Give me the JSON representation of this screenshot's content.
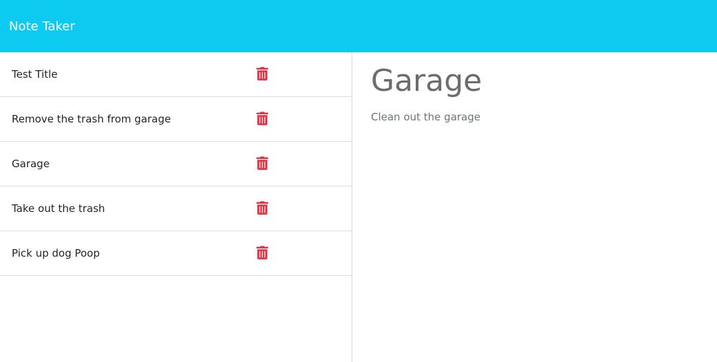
{
  "header": {
    "brand": "Note Taker"
  },
  "notes": [
    {
      "title": "Test Title"
    },
    {
      "title": "Remove the trash from garage"
    },
    {
      "title": "Garage"
    },
    {
      "title": "Take out the trash"
    },
    {
      "title": "Pick up dog Poop"
    }
  ],
  "active_note": {
    "title": "Garage",
    "text": "Clean out the garage"
  },
  "icons": {
    "delete": "trash-icon"
  },
  "colors": {
    "navbar": "#0dcaf0",
    "delete_icon": "#dc3545",
    "brand_text": "#ffffff"
  }
}
